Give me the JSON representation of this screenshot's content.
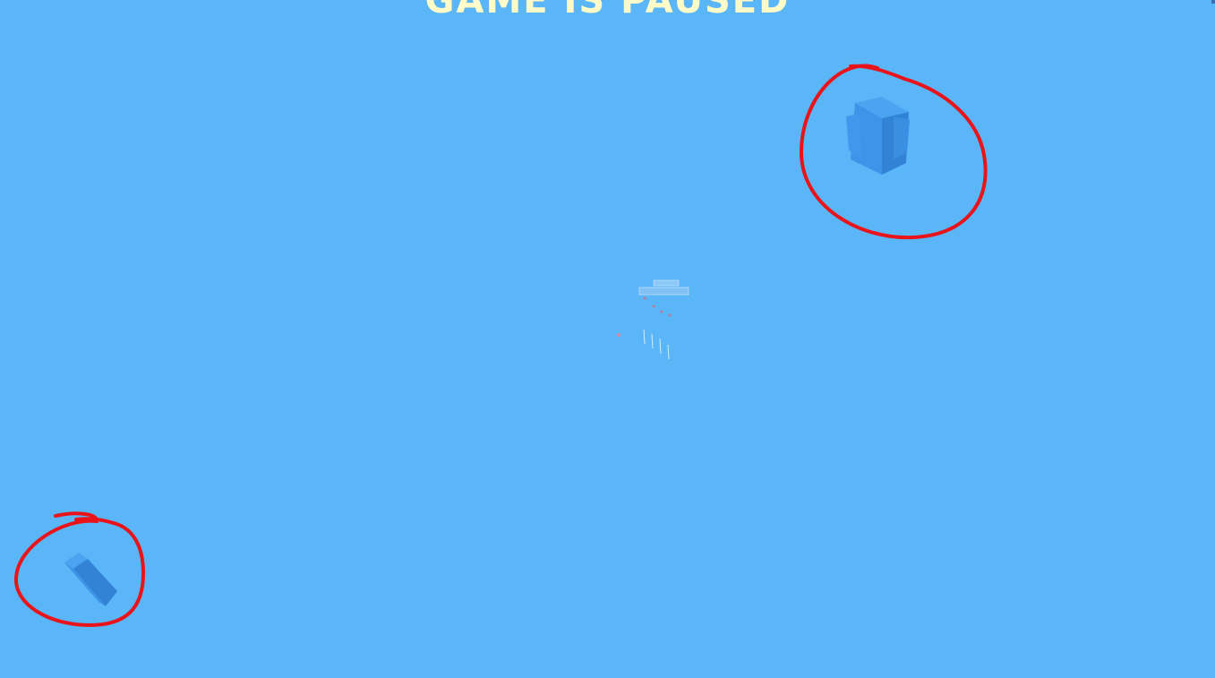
{
  "banner": {
    "text": "GAME IS PAUSED"
  },
  "colors": {
    "sky": "#5bb6f7",
    "banner_text": "#fffbc8",
    "annotation_circle": "#e8141a",
    "block_front": "#3d94e8",
    "block_side": "#3282d6",
    "block_top": "#4aa4f0"
  },
  "scene": {
    "annotations": [
      {
        "name": "circle-around-pillar-top-right",
        "color": "red"
      },
      {
        "name": "circle-around-block-bottom-left",
        "color": "red"
      }
    ],
    "objects": [
      {
        "name": "pillar-cluster",
        "icon": "stacked-blocks"
      },
      {
        "name": "fallen-block",
        "icon": "tilted-block"
      },
      {
        "name": "distant-structure",
        "icon": "tiny-far-away-objects"
      }
    ]
  }
}
